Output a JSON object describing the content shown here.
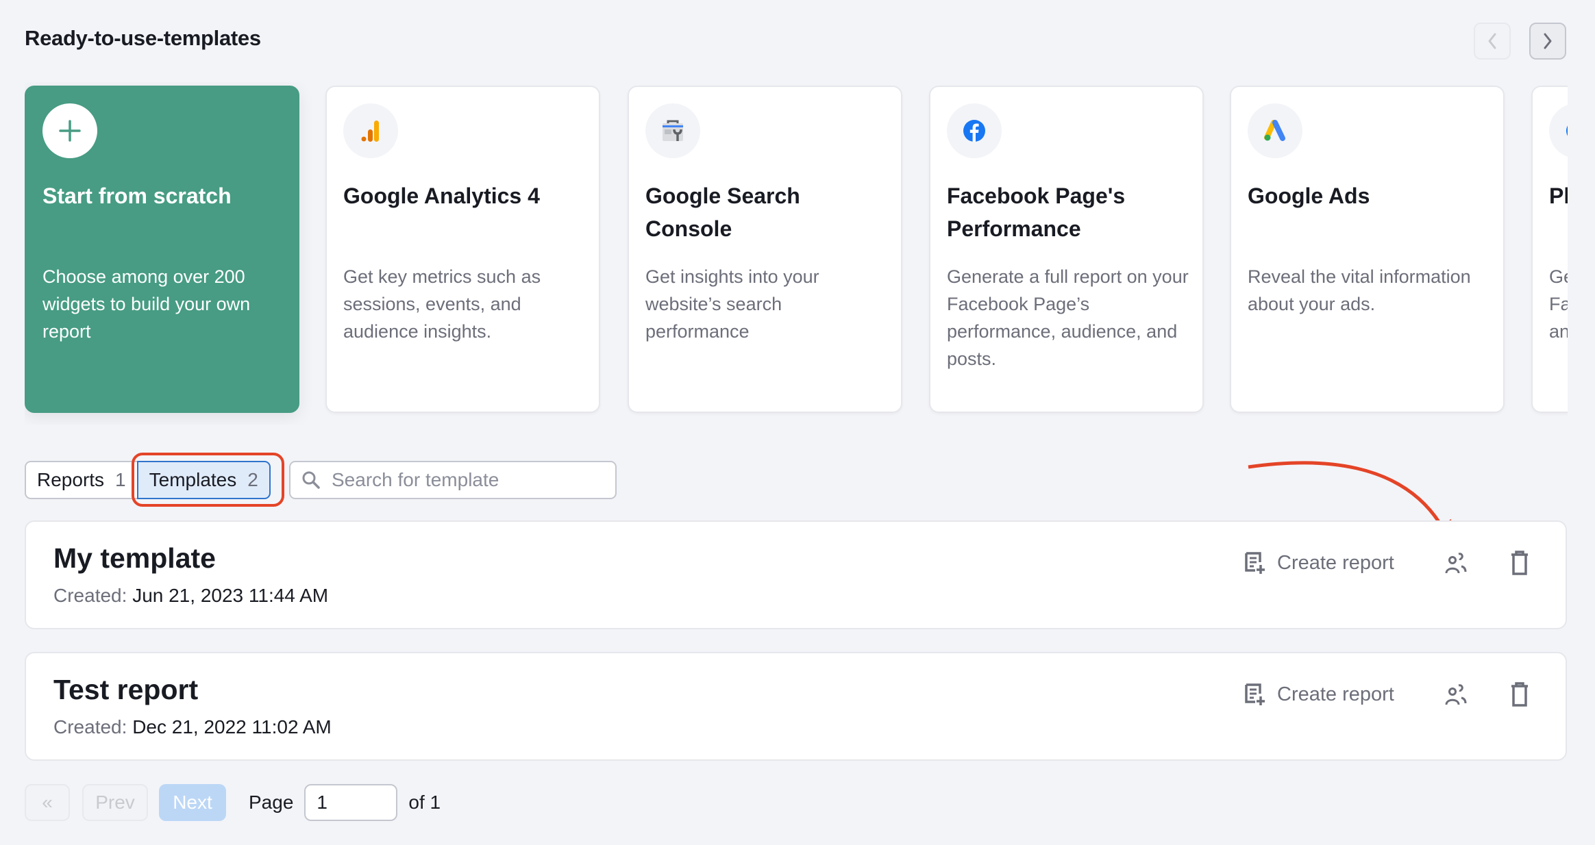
{
  "header": {
    "title": "Ready-to-use-templates",
    "prev_icon": "chevron-left-icon",
    "next_icon": "chevron-right-icon"
  },
  "cards": [
    {
      "icon": "plus-icon",
      "title": "Start from scratch",
      "description": "Choose among over 200 widgets to build your own report"
    },
    {
      "icon": "google-analytics-icon",
      "title": "Google Analytics 4",
      "description": "Get key metrics such as sessions, events, and audience insights."
    },
    {
      "icon": "google-search-console-icon",
      "title": "Google Search Console",
      "description": "Get insights into your website’s search performance"
    },
    {
      "icon": "facebook-icon",
      "title": "Facebook Page's Performance",
      "description": "Generate a full report on your Facebook Page’s performance, audience, and posts."
    },
    {
      "icon": "google-ads-icon",
      "title": "Google Ads",
      "description": "Reveal the vital information about your ads."
    },
    {
      "icon": "partial-card-icon",
      "title": "Pl",
      "description": "Ge Fa an"
    }
  ],
  "tabs": [
    {
      "label": "Reports",
      "count": "1",
      "active": false
    },
    {
      "label": "Templates",
      "count": "2",
      "active": true
    }
  ],
  "search": {
    "placeholder": "Search for template",
    "value": ""
  },
  "rows": [
    {
      "title": "My template",
      "created_label": "Created:",
      "created_value": "Jun 21, 2023 11:44 AM",
      "create_label": "Create report"
    },
    {
      "title": "Test report",
      "created_label": "Created:",
      "created_value": "Dec 21, 2022 11:02 AM",
      "create_label": "Create report"
    }
  ],
  "pagination": {
    "first_label": "«",
    "prev_label": "Prev",
    "next_label": "Next",
    "page_label": "Page",
    "current_page": "1",
    "of_label": "of 1"
  },
  "colors": {
    "accent_green": "#479c83",
    "active_tab_bg": "#e0ebfa",
    "active_tab_border": "#2f74cc",
    "annotation_red": "#e44427"
  }
}
